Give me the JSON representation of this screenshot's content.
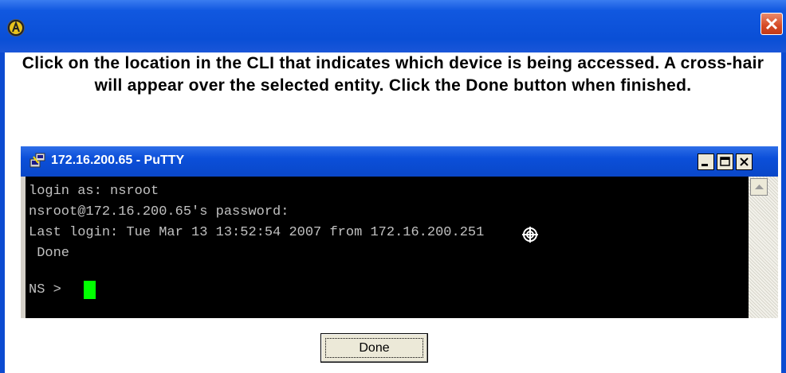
{
  "dialog": {
    "instruction": "Click on the location in the CLI that indicates which device is being accessed. A cross-hair will appear over the selected entity. Click the Done button when finished.",
    "done_label": "Done",
    "icons": {
      "app": "app-logo-icon",
      "close": "close-icon"
    },
    "colors": {
      "titlebar": "#0a4fd6",
      "close": "#d64a25"
    }
  },
  "putty": {
    "title": "172.16.200.65 - PuTTY",
    "icons": {
      "app": "putty-icon",
      "minimize": "minimize-icon",
      "maximize": "maximize-icon",
      "close": "close-icon",
      "scroll_up": "scroll-up-arrow-icon",
      "crosshair": "crosshair-icon"
    },
    "terminal_lines": [
      "login as: nsroot",
      "nsroot@172.16.200.65's password:",
      "Last login: Tue Mar 13 13:52:54 2007 from 172.16.200.251",
      " Done",
      "NS > "
    ],
    "colors": {
      "background": "#000000",
      "text": "#c0c0c0",
      "cursor": "#00ff00"
    }
  }
}
